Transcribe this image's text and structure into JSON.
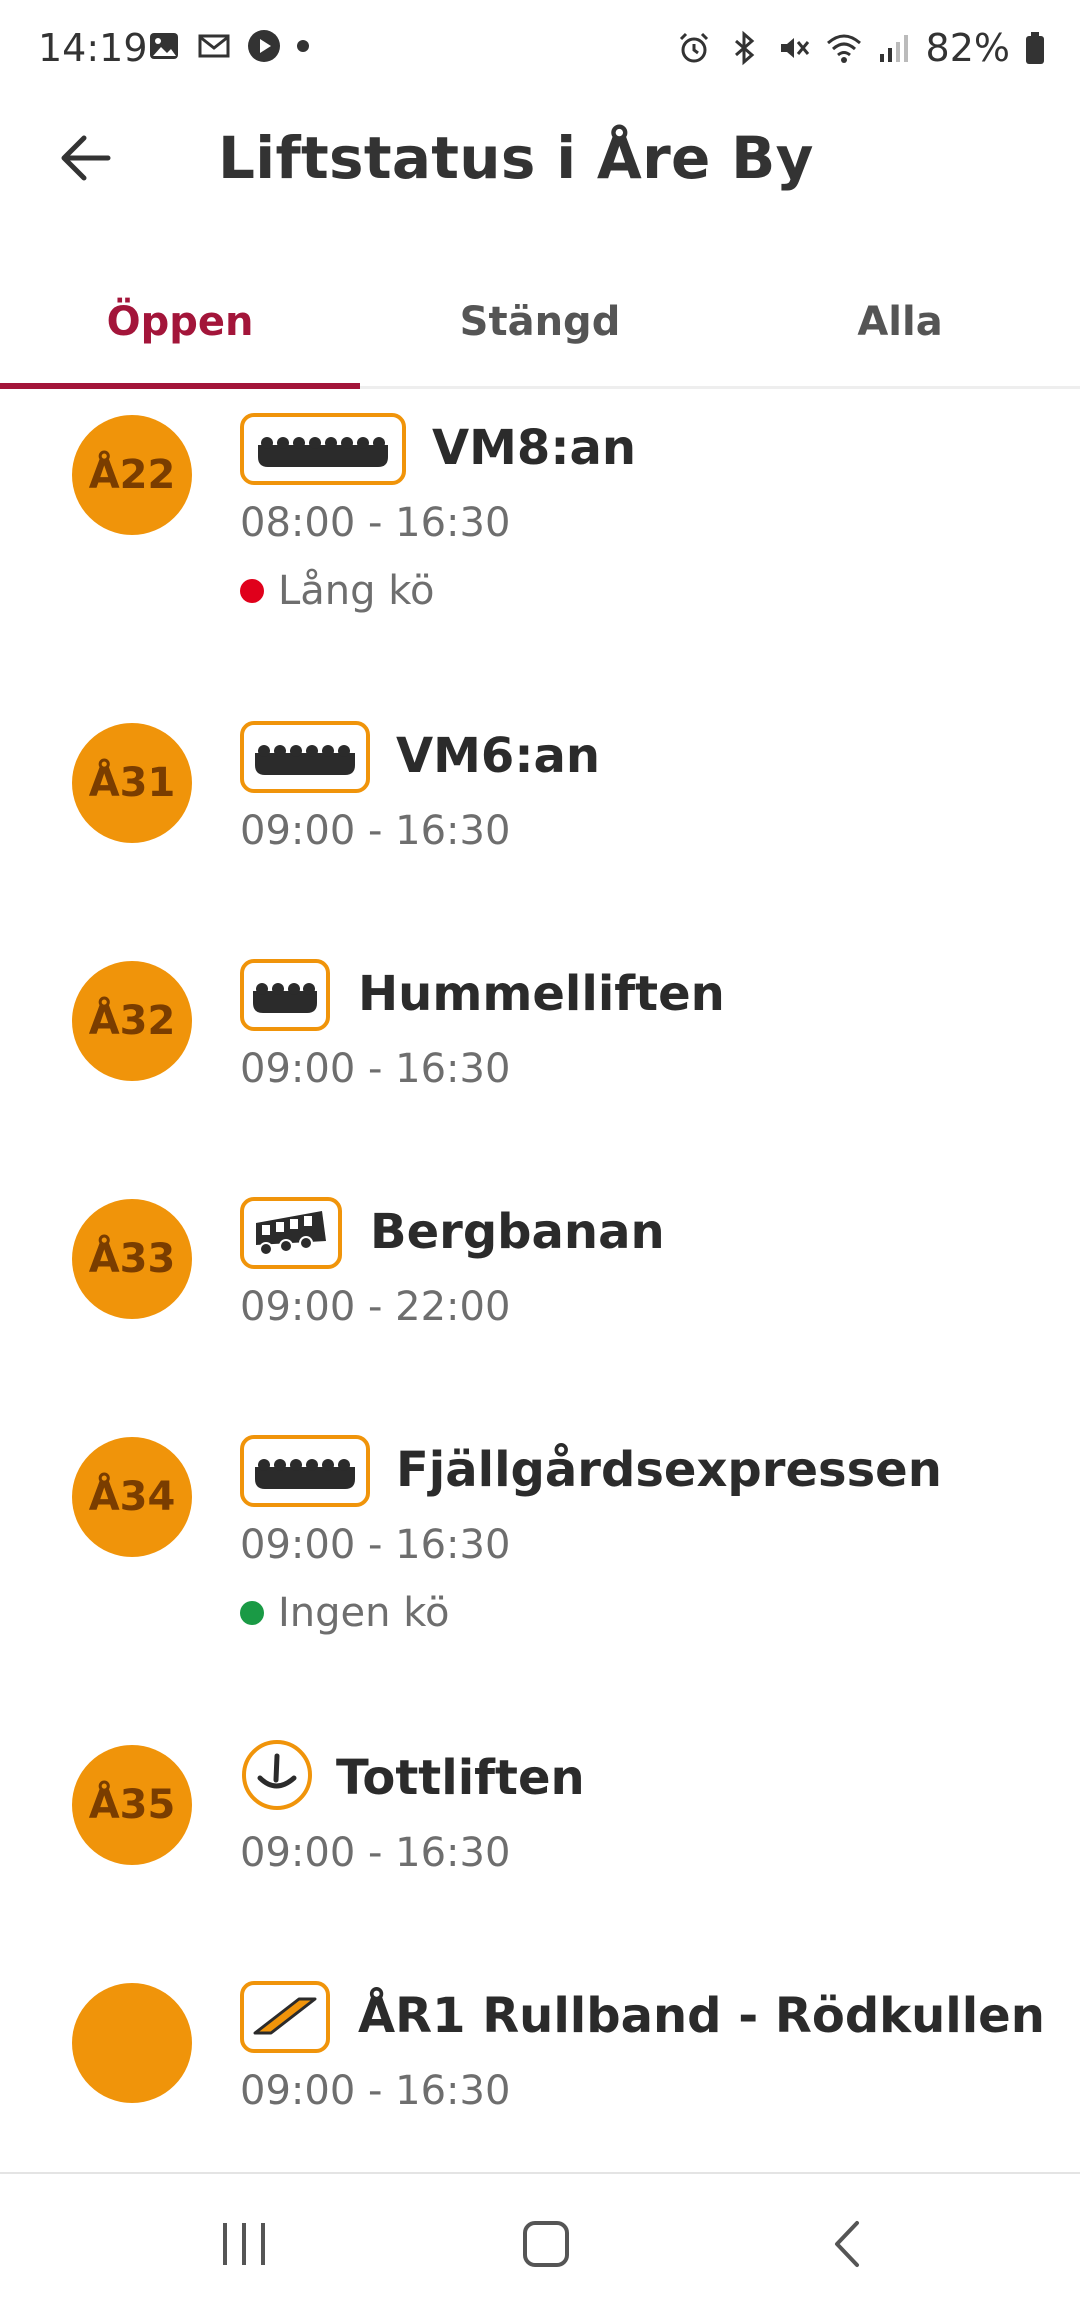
{
  "status_bar": {
    "time": "14:19",
    "battery": "82%",
    "left_icons": [
      "gallery-icon",
      "gmail-icon",
      "youtube-icon",
      "dot-icon"
    ],
    "right_icons": [
      "alarm-icon",
      "bluetooth-icon",
      "mute-icon",
      "wifi-icon",
      "signal-icon",
      "battery-icon"
    ]
  },
  "header": {
    "title": "Liftstatus i Åre By",
    "back_icon": "arrow-left-icon"
  },
  "tabs": [
    {
      "label": "Öppen",
      "active": true
    },
    {
      "label": "Stängd",
      "active": false
    },
    {
      "label": "Alla",
      "active": false
    }
  ],
  "lifts": [
    {
      "code": "Å22",
      "type_icon": "gondola-8-icon",
      "name": "VM8:an",
      "hours": "08:00 - 16:30",
      "queue": {
        "label": "Lång kö",
        "color": "#e0001b"
      }
    },
    {
      "code": "Å31",
      "type_icon": "chairlift-6-icon",
      "name": "VM6:an",
      "hours": "09:00 - 16:30"
    },
    {
      "code": "Å32",
      "type_icon": "chairlift-4-icon",
      "name": "Hummelliften",
      "hours": "09:00 - 16:30"
    },
    {
      "code": "Å33",
      "type_icon": "funicular-icon",
      "name": "Bergbanan",
      "hours": "09:00 - 22:00"
    },
    {
      "code": "Å34",
      "type_icon": "chairlift-6-icon",
      "name": "Fjällgårdsexpressen",
      "hours": "09:00 - 16:30",
      "queue": {
        "label": "Ingen kö",
        "color": "#1a9a45"
      }
    },
    {
      "code": "Å35",
      "type_icon": "t-bar-icon",
      "name": "Tottliften",
      "hours": "09:00 - 16:30"
    },
    {
      "code": "",
      "type_icon": "conveyor-icon",
      "name": "ÅR1 Rullband - Rödkullen",
      "hours": "09:00 - 16:30"
    }
  ],
  "nav_bar": {
    "buttons": [
      "recent-apps-icon",
      "home-icon",
      "back-icon"
    ]
  },
  "colors": {
    "accent": "#a3153a",
    "badge": "#f0940a",
    "badge_text": "#7a3d00"
  }
}
